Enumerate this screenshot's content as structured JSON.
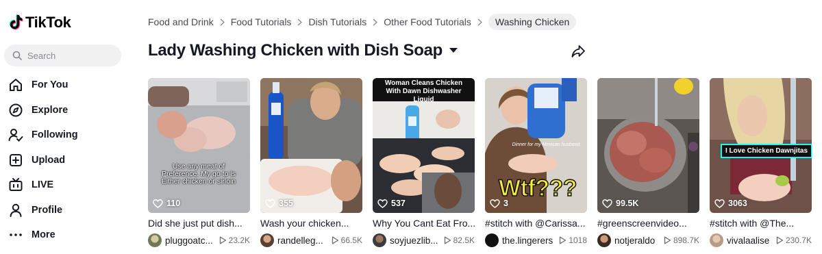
{
  "app": {
    "name": "TikTok"
  },
  "search": {
    "placeholder": "Search"
  },
  "nav": [
    {
      "label": "For You",
      "icon": "home-icon"
    },
    {
      "label": "Explore",
      "icon": "compass-icon"
    },
    {
      "label": "Following",
      "icon": "following-icon"
    },
    {
      "label": "Upload",
      "icon": "upload-icon"
    },
    {
      "label": "LIVE",
      "icon": "live-icon"
    },
    {
      "label": "Profile",
      "icon": "profile-icon"
    },
    {
      "label": "More",
      "icon": "more-icon"
    }
  ],
  "breadcrumb": {
    "items": [
      "Food and Drink",
      "Food Tutorials",
      "Dish Tutorials",
      "Other Food Tutorials"
    ],
    "current": "Washing Chicken"
  },
  "page": {
    "title": "Lady Washing Chicken with Dish Soap"
  },
  "videos": [
    {
      "likes": "110",
      "caption": "Did she just put dish...",
      "user": "pluggoatc...",
      "views": "23.2K",
      "overlay": "Use any meat of Preference. My go to is Either chicken or sirloin"
    },
    {
      "likes": "355",
      "caption": "Wash your chicken...",
      "user": "randelleg...",
      "views": "66.5K"
    },
    {
      "likes": "537",
      "caption": "Why You Cant Eat Fro...",
      "user": "soyjuezlib...",
      "views": "82.5K",
      "overlay": "Woman Cleans Chicken With Dawn Dishwasher Liquid"
    },
    {
      "likes": "3",
      "caption": "#stitch with @Carissa...",
      "user": "the.lingerers",
      "views": "1018",
      "overlay": "Wtf???",
      "overlay_small": "Dinner for my Mexican husband"
    },
    {
      "likes": "99.5K",
      "caption": "#greenscreenvideo...",
      "user": "notjeraldo",
      "views": "898.7K"
    },
    {
      "likes": "3063",
      "caption": "#stitch with @The...",
      "user": "vivalaalise",
      "views": "230.7K",
      "overlay": "I Love Chicken Dawnjitas"
    }
  ],
  "colors": {
    "brand_cyan": "#25f4ee",
    "brand_pink": "#fe2c55",
    "text": "#161823",
    "muted": "#6b6c72"
  }
}
